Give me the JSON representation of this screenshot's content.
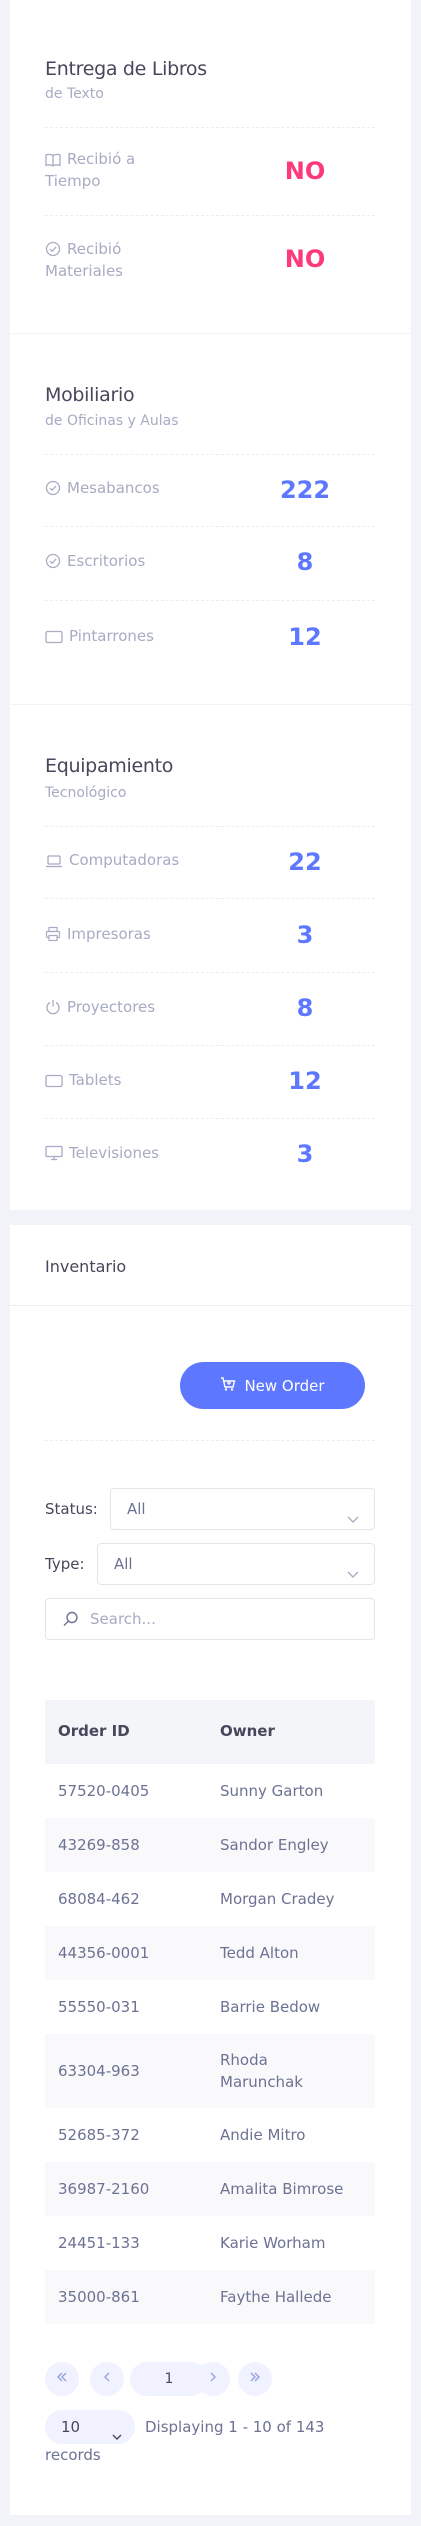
{
  "entrega": {
    "title": "Entrega de Libros",
    "subtitle": "de Texto",
    "rows": [
      {
        "label": "Recibió a Tiempo",
        "value": "NO",
        "icon": "book-icon"
      },
      {
        "label": "Recibió Materiales",
        "value": "NO",
        "icon": "check-circle-icon"
      }
    ]
  },
  "mobiliario": {
    "title": "Mobiliario",
    "subtitle": "de Oficinas y Aulas",
    "rows": [
      {
        "label": "Mesabancos",
        "value": "222",
        "icon": "check-circle-icon"
      },
      {
        "label": "Escritorios",
        "value": "8",
        "icon": "check-circle-icon"
      },
      {
        "label": "Pintarrones",
        "value": "12",
        "icon": "board-icon"
      }
    ]
  },
  "equipamiento": {
    "title": "Equipamiento",
    "subtitle": "Tecnológico",
    "rows": [
      {
        "label": "Computadoras",
        "value": "22",
        "icon": "laptop-icon"
      },
      {
        "label": "Impresoras",
        "value": "3",
        "icon": "printer-icon"
      },
      {
        "label": "Proyectores",
        "value": "8",
        "icon": "power-icon"
      },
      {
        "label": "Tablets",
        "value": "12",
        "icon": "tablet-icon"
      },
      {
        "label": "Televisiones",
        "value": "3",
        "icon": "monitor-icon"
      }
    ]
  },
  "inventario": {
    "title": "Inventario",
    "new_order_label": "New Order",
    "status_label": "Status:",
    "status_value": "All",
    "type_label": "Type:",
    "type_value": "All",
    "search_placeholder": "Search...",
    "columns": [
      "Order ID",
      "Owner"
    ],
    "rows": [
      [
        "57520-0405",
        "Sunny Garton"
      ],
      [
        "43269-858",
        "Sandor Engley"
      ],
      [
        "68084-462",
        "Morgan Cradey"
      ],
      [
        "44356-0001",
        "Tedd Alton"
      ],
      [
        "55550-031",
        "Barrie Bedow"
      ],
      [
        "63304-963",
        "Rhoda Marunchak"
      ],
      [
        "52685-372",
        "Andie Mitro"
      ],
      [
        "36987-2160",
        "Amalita Bimrose"
      ],
      [
        "24451-133",
        "Karie Worham"
      ],
      [
        "35000-861",
        "Faythe Hallede"
      ]
    ],
    "pagination": {
      "current_page": "1",
      "page_size": "10",
      "records_text": "Displaying 1 - 10 of 143 records"
    }
  },
  "colors": {
    "accent": "#5d78ff",
    "danger": "#fd397a"
  }
}
